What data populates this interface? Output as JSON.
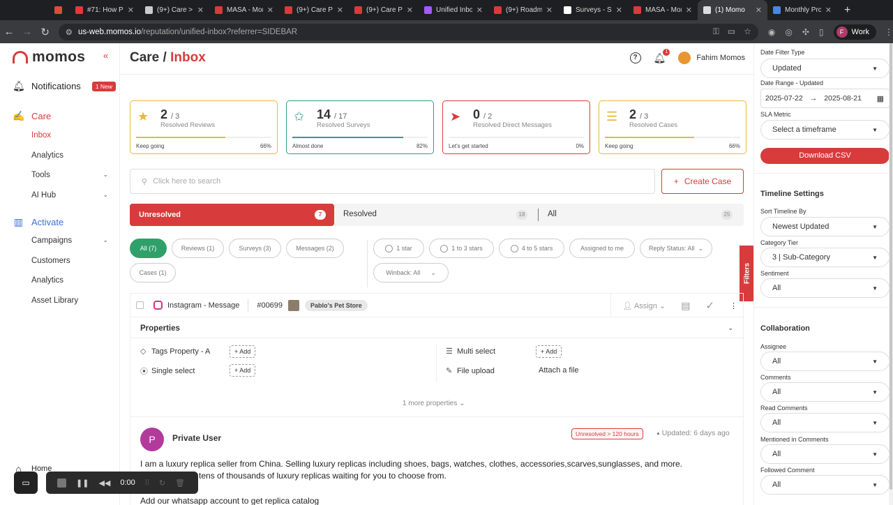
{
  "browser": {
    "tabs": [
      {
        "label": "",
        "color": "#e04a3a"
      },
      {
        "label": "#71: How Pl",
        "color": "#e03a3a"
      },
      {
        "label": "(9+) Care >",
        "color": "#cccccc"
      },
      {
        "label": "MASA - Mon",
        "color": "#d83b3b"
      },
      {
        "label": "(9+) Care Po",
        "color": "#d83b3b"
      },
      {
        "label": "(9+) Care Po",
        "color": "#d83b3b"
      },
      {
        "label": "Unified Inbo",
        "color": "#a259ff"
      },
      {
        "label": "(9+) Roadm",
        "color": "#d83b3b"
      },
      {
        "label": "Surveys - S",
        "color": "#ffffff"
      },
      {
        "label": "MASA - Mon",
        "color": "#d83b3b"
      },
      {
        "label": "(1) Momo",
        "color": "#dddddd"
      },
      {
        "label": "Monthly Pro",
        "color": "#4a86e8"
      }
    ],
    "url_host": "us-web.momos.io",
    "url_path": "/reputation/unified-inbox?referrer=SIDEBAR",
    "profile_initial": "F",
    "profile_label": "Work"
  },
  "sidebar": {
    "logo": "momos",
    "notifications_label": "Notifications",
    "notifications_badge": "1 New",
    "care_label": "Care",
    "care_items": [
      {
        "label": "Inbox",
        "chevron": ""
      },
      {
        "label": "Analytics",
        "chevron": ""
      },
      {
        "label": "Tools",
        "chevron": "⌄"
      },
      {
        "label": "AI Hub",
        "chevron": "⌄"
      }
    ],
    "activate_label": "Activate",
    "activate_items": [
      {
        "label": "Campaigns",
        "chevron": "⌄"
      },
      {
        "label": "Customers",
        "chevron": ""
      },
      {
        "label": "Analytics",
        "chevron": ""
      },
      {
        "label": "Asset Library",
        "chevron": ""
      }
    ],
    "home_label": "Home"
  },
  "header": {
    "crumb": "Care /",
    "title": "Inbox",
    "bell_count": "1",
    "user_name": "Fahim Momos"
  },
  "stats": [
    {
      "num": "2",
      "total": "/ 3",
      "label": "Resolved Reviews",
      "msg": "Keep going",
      "pct": "66%",
      "progress": 0.66,
      "color": "#e8b83a",
      "icon": "★"
    },
    {
      "num": "14",
      "total": "/ 17",
      "label": "Resolved Surveys",
      "msg": "Almost done",
      "pct": "82%",
      "progress": 0.82,
      "color": "#2f9c8c",
      "icon": "✩"
    },
    {
      "num": "0",
      "total": "/ 2",
      "label": "Resolved Direct Messages",
      "msg": "Let's get started",
      "pct": "0%",
      "progress": 0.0,
      "color": "#d83b3b",
      "icon": "➤"
    },
    {
      "num": "2",
      "total": "/ 3",
      "label": "Resolved Cases",
      "msg": "Keep going",
      "pct": "66%",
      "progress": 0.66,
      "color": "#e8b83a",
      "icon": "☰"
    }
  ],
  "search": {
    "placeholder": "Click here to search"
  },
  "create_case": "Create Case",
  "segments": {
    "unresolved": "Unresolved",
    "unresolved_count": "7",
    "resolved": "Resolved",
    "resolved_count": "18",
    "all": "All",
    "all_count": "25"
  },
  "chips": {
    "all": "All (7)",
    "reviews": "Reviews (1)",
    "surveys": "Surveys (3)",
    "messages": "Messages (2)",
    "cases": "Cases (1)",
    "star1": "1 star",
    "star13": "1 to 3 stars",
    "star45": "4 to 5 stars",
    "assigned": "Assigned to me",
    "reply": "Reply Status: All",
    "winback": "Winback: All"
  },
  "filters_tab": "Filters",
  "card": {
    "source": "Instagram - Message",
    "id": "#00699",
    "store": "Pablo's Pet Store",
    "assign": "Assign",
    "properties": "Properties",
    "tags_prop": "Tags Property - A",
    "single_select": "Single select",
    "multi_select": "Multi select",
    "file_upload": "File upload",
    "attach": "Attach a file",
    "add": "+ Add",
    "more_props": "1 more properties",
    "author_initial": "P",
    "author": "Private User",
    "status_tag": "Unresolved > 120 hours",
    "updated": "Updated: 6 days ago",
    "message_line1": "I am a luxury replica seller from China. Selling luxury replicas including shoes, bags, watches, clothes, accessories,scarves,sunglasses, and more.",
    "message_line2": "My catalog has tens of thousands of luxury replicas waiting for you to choose from.",
    "message_line3": "Add our whatsapp account to get replica catalog"
  },
  "rpanel": {
    "date_filter_type_label": "Date Filter Type",
    "date_filter_type": "Updated",
    "date_range_label": "Date Range - Updated",
    "date_from": "2025-07-22",
    "date_to": "2025-08-21",
    "sla_label": "SLA Metric",
    "sla_value": "Select a timeframe",
    "download": "Download CSV",
    "timeline_head": "Timeline Settings",
    "sort_label": "Sort Timeline By",
    "sort_value": "Newest Updated",
    "category_label": "Category Tier",
    "category_value": "3 | Sub-Category",
    "sentiment_label": "Sentiment",
    "sentiment_value": "All",
    "collab_head": "Collaboration",
    "assignee_label": "Assignee",
    "assignee_value": "All",
    "comments_label": "Comments",
    "comments_value": "All",
    "read_label": "Read Comments",
    "read_value": "All",
    "mentioned_label": "Mentioned in Comments",
    "mentioned_value": "All",
    "followed_label": "Followed Comment",
    "followed_value": "All"
  },
  "recorder": {
    "time": "0:00"
  }
}
